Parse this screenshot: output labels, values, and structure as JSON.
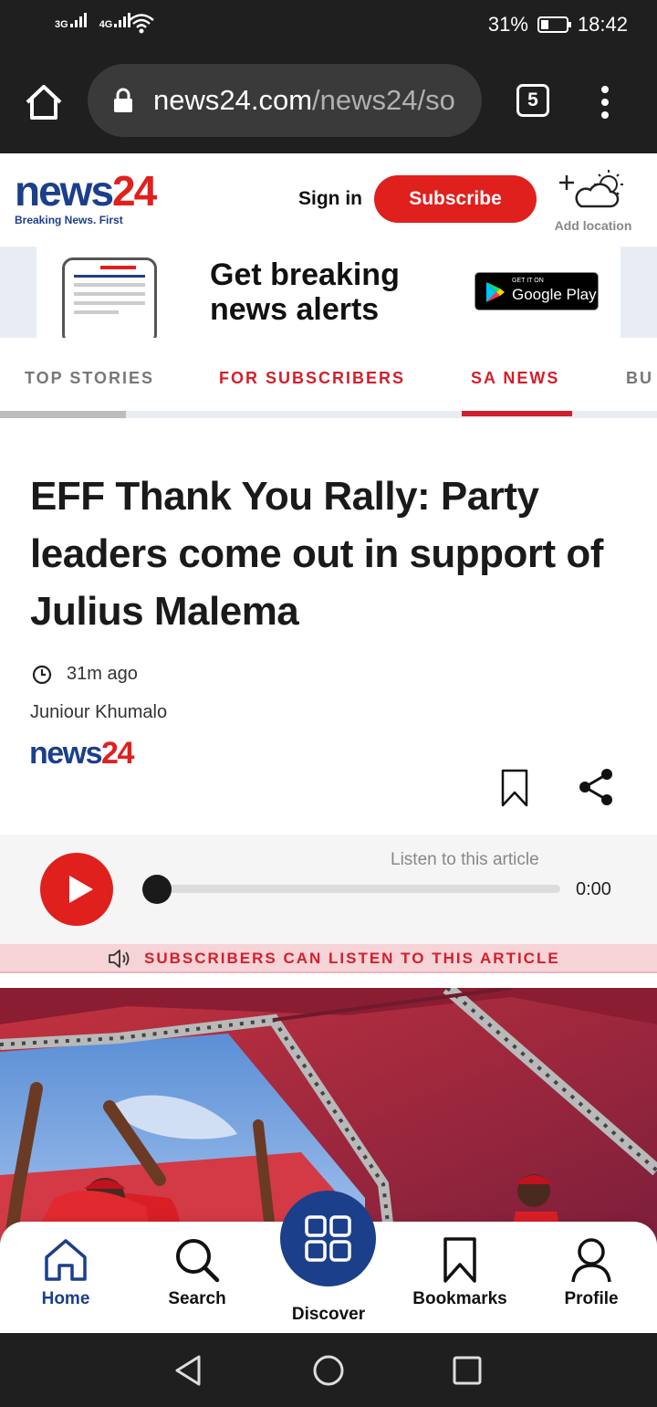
{
  "status_bar": {
    "signal1": "3G",
    "signal2": "4G",
    "battery": "31%",
    "battery_level": 0.31,
    "time": "18:42"
  },
  "browser": {
    "url_domain": "news24.com",
    "url_path": "/news24/so",
    "tab_count": "5"
  },
  "header": {
    "logo_news": "news",
    "logo_24": "24",
    "tagline": "Breaking News. First",
    "sign_in": "Sign in",
    "subscribe": "Subscribe",
    "add_location": "Add location"
  },
  "ad": {
    "headline_line1": "Get breaking",
    "headline_line2": "news alerts",
    "store_small": "GET IT ON",
    "store_big": "Google Play"
  },
  "section_tabs": {
    "items": [
      {
        "label": "TOP STORIES"
      },
      {
        "label": "FOR SUBSCRIBERS"
      },
      {
        "label": "SA NEWS"
      },
      {
        "label": "BU"
      }
    ],
    "active": "SA NEWS"
  },
  "article": {
    "headline": "EFF Thank You Rally: Party leaders come out in support of Julius Malema",
    "time_ago": "31m ago",
    "author": "Juniour Khumalo",
    "source_news": "news",
    "source_24": "24"
  },
  "player": {
    "listen_label": "Listen to this article",
    "duration": "0:00",
    "progress": 0,
    "subscriber_note": "SUBSCRIBERS CAN LISTEN TO THIS ARTICLE"
  },
  "bottom_nav": {
    "home": "Home",
    "search": "Search",
    "discover": "Discover",
    "bookmarks": "Bookmarks",
    "profile": "Profile"
  },
  "colors": {
    "brand_red": "#e0201d",
    "brand_blue": "#1b3f8b",
    "tab_red": "#d21f2b"
  }
}
